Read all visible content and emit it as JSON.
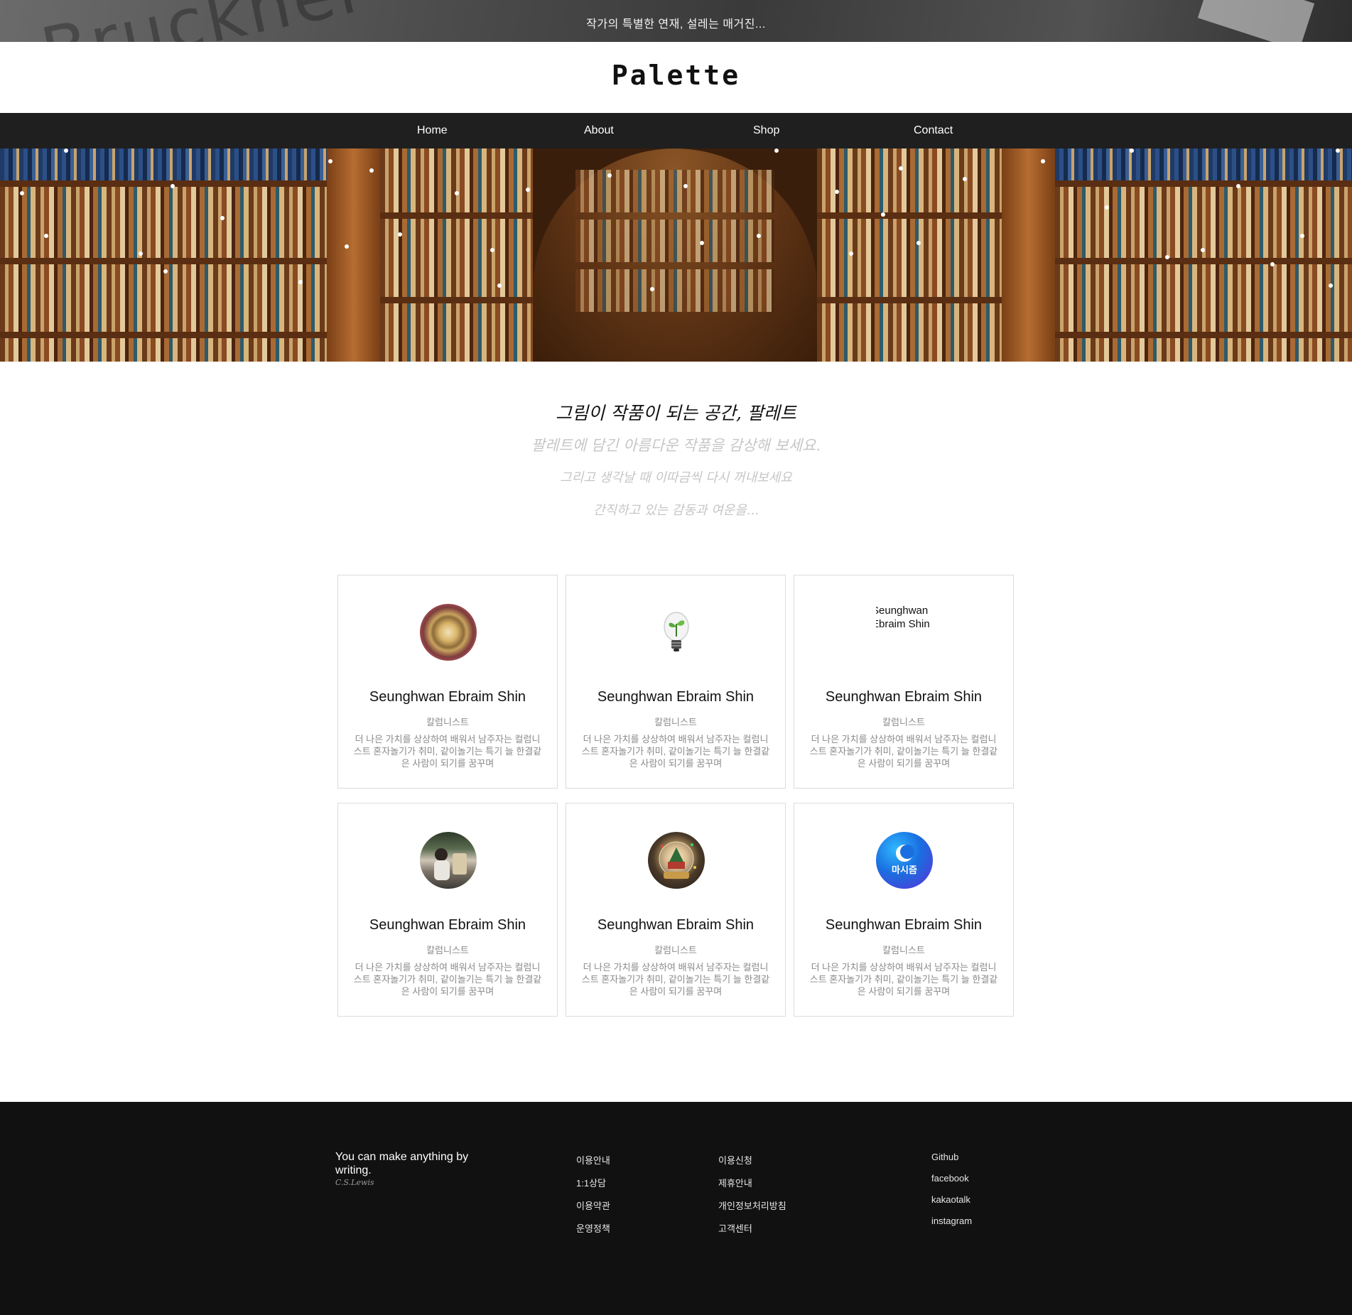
{
  "topbar": {
    "message": "작가의 특별한 연재, 설레는 매거진...",
    "decoration_text": "Bruckner"
  },
  "logo": {
    "text": "Palette"
  },
  "nav": {
    "items": [
      {
        "label": "Home"
      },
      {
        "label": "About"
      },
      {
        "label": "Shop"
      },
      {
        "label": "Contact"
      }
    ]
  },
  "intro": {
    "title": "그림이 작품이 되는 공간, 팔레트",
    "line1": "팔레트에 담긴 아름다운 작품을 감상해 보세요.",
    "line2": "그리고 생각날 때 이따금씩 다시 꺼내보세요",
    "line3": "간직하고 있는 감동과 여운을..."
  },
  "cards": [
    {
      "name": "Seunghwan Ebraim Shin",
      "role": "칼럼니스트",
      "desc": "더 나은 가치를 상상하여 배워서 남주자는 컬럼니스트 혼자놀기가 취미, 같이놀기는 특기 늘 한결같은 사람이 되기를 꿈꾸며",
      "avatar": "ornate-mirror-photo"
    },
    {
      "name": "Seunghwan Ebraim Shin",
      "role": "칼럼니스트",
      "desc": "더 나은 가치를 상상하여 배워서 남주자는 컬럼니스트 혼자놀기가 취미, 같이놀기는 특기 늘 한결같은 사람이 되기를 꿈꾸며",
      "avatar": "lightbulb-plant"
    },
    {
      "name": "Seunghwan Ebraim Shin",
      "role": "칼럼니스트",
      "desc": "더 나은 가치를 상상하여 배워서 남주자는 컬럼니스트 혼자놀기가 취미, 같이놀기는 특기 늘 한결같은 사람이 되기를 꿈꾸며",
      "avatar": "broken-image",
      "alt": "Seunghwan Ebraim Shin"
    },
    {
      "name": "Seunghwan Ebraim Shin",
      "role": "칼럼니스트",
      "desc": "더 나은 가치를 상상하여 배워서 남주자는 컬럼니스트 혼자놀기가 취미, 같이놀기는 특기 늘 한결같은 사람이 되기를 꿈꾸며",
      "avatar": "person-photo"
    },
    {
      "name": "Seunghwan Ebraim Shin",
      "role": "칼럼니스트",
      "desc": "더 나은 가치를 상상하여 배워서 남주자는 컬럼니스트 혼자놀기가 취미, 같이놀기는 특기 늘 한결같은 사람이 되기를 꿈꾸며",
      "avatar": "snow-globe"
    },
    {
      "name": "Seunghwan Ebraim Shin",
      "role": "칼럼니스트",
      "desc": "더 나은 가치를 상상하여 배워서 남주자는 컬럼니스트 혼자놀기가 취미, 같이놀기는 특기 늘 한결같은 사람이 되기를 꿈꾸며",
      "avatar": "masijum-logo",
      "logo_text": "마시즘"
    }
  ],
  "footer": {
    "quote": "You can make anything by writing.",
    "quote_author": "C.S.Lewis",
    "col1": [
      "이용안내",
      "1:1상담",
      "이용약관",
      "운영정책"
    ],
    "col2": [
      "이용신청",
      "제휴안내",
      "개인정보처리방침",
      "고객센터"
    ],
    "social": [
      "Github",
      "facebook",
      "kakaotalk",
      "instagram"
    ]
  },
  "colors": {
    "nav_bg": "#1f1f1f",
    "footer_bg": "#111111",
    "muted_text": "#8a8a8a",
    "intro_sub_text": "#c6c6c6"
  }
}
